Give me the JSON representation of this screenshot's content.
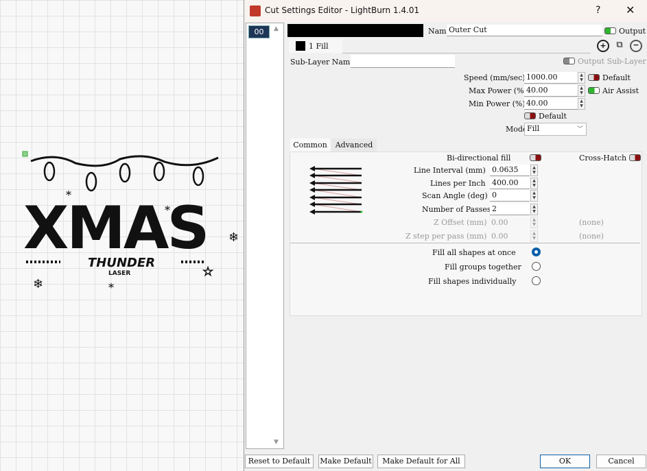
{
  "canvas": {
    "design_title": "XMAS",
    "logo_top": "THUNDER",
    "logo_bottom": "LASER"
  },
  "window": {
    "title": "Cut Settings Editor - LightBurn 1.4.01",
    "help": "?",
    "close": "✕"
  },
  "layers": {
    "selected": "00"
  },
  "header": {
    "name_label": "Name",
    "name_value": "Outer Cut",
    "output_label": "Output",
    "layer_color": "#000000"
  },
  "sublayer_tab": {
    "label": "1 Fill"
  },
  "sublayer": {
    "name_label": "Sub-Layer Name",
    "name_value": "",
    "output_label": "Output Sub-Layer"
  },
  "settings": {
    "speed_label": "Speed (mm/sec)",
    "speed": "1000.00",
    "speed_default": "Default",
    "max_power_label": "Max Power (%)",
    "max_power": "40.00",
    "air_assist": "Air Assist",
    "min_power_label": "Min Power (%)",
    "min_power": "40.00",
    "power_default": "Default",
    "mode_label": "Mode",
    "mode": "Fill"
  },
  "tabs": [
    "Common",
    "Advanced"
  ],
  "common": {
    "bidir_label": "Bi-directional fill",
    "crosshatch_label": "Cross-Hatch",
    "line_interval_label": "Line Interval (mm)",
    "line_interval": "0.0635",
    "lpi_label": "Lines per Inch",
    "lpi": "400.00",
    "scan_angle_label": "Scan Angle (deg)",
    "scan_angle": "0",
    "passes_label": "Number of Passes",
    "passes": "2",
    "z_offset_label": "Z Offset (mm)",
    "z_offset": "0.00",
    "z_offset_note": "(none)",
    "z_step_label": "Z step per pass (mm)",
    "z_step": "0.00",
    "z_step_note": "(none)",
    "fill_options": [
      {
        "label": "Fill all shapes at once",
        "selected": true
      },
      {
        "label": "Fill groups together",
        "selected": false
      },
      {
        "label": "Fill shapes individually",
        "selected": false
      }
    ]
  },
  "footer": {
    "reset": "Reset to Default",
    "make_default": "Make Default",
    "make_default_all": "Make Default for All",
    "ok": "OK",
    "cancel": "Cancel"
  }
}
